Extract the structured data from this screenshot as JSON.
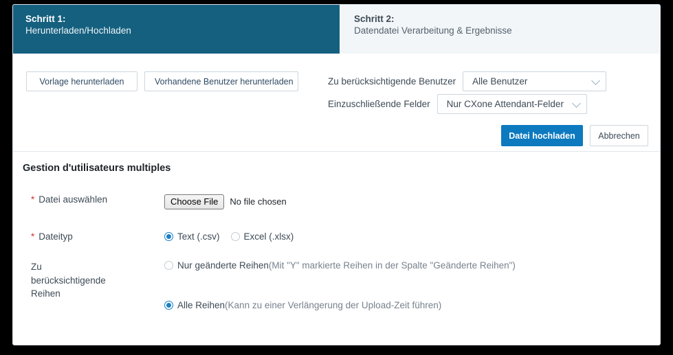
{
  "steps": [
    {
      "number": "Schritt 1:",
      "description": "Herunterladen/Hochladen"
    },
    {
      "number": "Schritt 2:",
      "description": "Datendatei Verarbeitung & Ergebnisse"
    }
  ],
  "toolbar": {
    "download_template_label": "Vorlage herunterladen",
    "download_existing_label": "Vorhandene Benutzer herunterladen",
    "users_label": "Zu berücksichtigende Benutzer",
    "users_value": "Alle Benutzer",
    "fields_label": "Einzuschließende Felder",
    "fields_value": "Nur CXone Attendant-Felder",
    "upload_label": "Datei hochladen",
    "cancel_label": "Abbrechen"
  },
  "form": {
    "title": "Gestion d'utilisateurs multiples",
    "required_marker": "*",
    "file_row": {
      "label": "Datei auswählen",
      "button_label": "Choose File",
      "status": "No file chosen"
    },
    "filetype_row": {
      "label": "Dateityp",
      "options": [
        {
          "label": "Text (.csv)",
          "selected": true
        },
        {
          "label": "Excel (.xlsx)",
          "selected": false
        }
      ]
    },
    "rows_row": {
      "label": "Zu berücksichtigende Reihen",
      "options": [
        {
          "label": "Nur geänderte Reihen",
          "hint": "(Mit \"Y\" markierte Reihen in der Spalte \"Geänderte Reihen\")",
          "selected": false
        },
        {
          "label": "Alle Reihen",
          "hint": "(Kann zu einer Verlängerung der Upload-Zeit führen)",
          "selected": true
        }
      ]
    }
  },
  "colors": {
    "step_active": "#15607f",
    "step_inactive_bg": "#f2f6f9",
    "primary_button": "#0d7ac0",
    "required": "#d0342c",
    "radio_selected": "#1b7fc4"
  }
}
